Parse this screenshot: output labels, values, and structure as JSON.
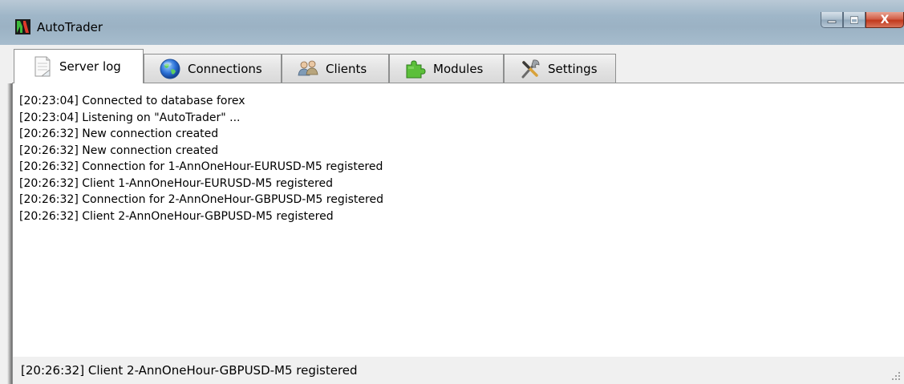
{
  "window": {
    "title": "AutoTrader",
    "app_icon": "autotrader-logo-icon",
    "caption_buttons": {
      "minimize_icon": "minimize-icon",
      "maximize_icon": "maximize-icon",
      "close_label": "X"
    }
  },
  "tabs": [
    {
      "label": "Server log",
      "icon": "document-icon",
      "active": true
    },
    {
      "label": "Connections",
      "icon": "globe-icon",
      "active": false
    },
    {
      "label": "Clients",
      "icon": "users-icon",
      "active": false
    },
    {
      "label": "Modules",
      "icon": "puzzle-piece-icon",
      "active": false
    },
    {
      "label": "Settings",
      "icon": "tools-icon",
      "active": false
    }
  ],
  "log": [
    "[20:23:04] Connected to database forex",
    "[20:23:04] Listening on \"AutoTrader\" ...",
    "[20:26:32] New connection created",
    "[20:26:32] New connection created",
    "[20:26:32] Connection for 1-AnnOneHour-EURUSD-M5 registered",
    "[20:26:32] Client 1-AnnOneHour-EURUSD-M5 registered",
    "[20:26:32] Connection for 2-AnnOneHour-GBPUSD-M5 registered",
    "[20:26:32] Client 2-AnnOneHour-GBPUSD-M5 registered"
  ],
  "statusbar": {
    "text": "[20:26:32] Client 2-AnnOneHour-GBPUSD-M5 registered"
  },
  "colors": {
    "close_button": "#c1391d",
    "titlebar": "#9fb6c8",
    "tab_border": "#8e8f8f"
  }
}
